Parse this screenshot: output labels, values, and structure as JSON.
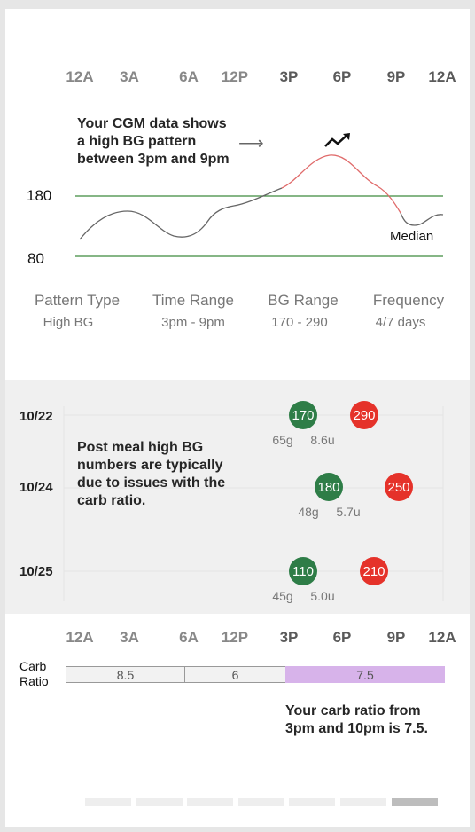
{
  "hours": [
    "12A",
    "3A",
    "6A",
    "12P",
    "3P",
    "6P",
    "9P",
    "12A"
  ],
  "top": {
    "message": [
      "Your CGM data shows",
      "a high BG pattern",
      "between 3pm and 9pm"
    ],
    "arrow": "⟶",
    "y_labels": [
      "180",
      "80"
    ],
    "median_label": "Median"
  },
  "stats": {
    "headers": [
      "Pattern Type",
      "Time Range",
      "BG Range",
      "Frequency"
    ],
    "values": [
      "High BG",
      "3pm - 9pm",
      "170 - 290",
      "4/7 days"
    ]
  },
  "meals": {
    "message": [
      "Post meal high BG",
      "numbers are typically",
      "due to issues with the",
      "carb ratio."
    ],
    "rows": [
      {
        "date": "10/22",
        "pre": "170",
        "post": "290",
        "carbs": "65g",
        "insulin": "8.6u"
      },
      {
        "date": "10/24",
        "pre": "180",
        "post": "250",
        "carbs": "48g",
        "insulin": "5.7u"
      },
      {
        "date": "10/25",
        "pre": "110",
        "post": "210",
        "carbs": "45g",
        "insulin": "5.0u"
      }
    ]
  },
  "carb": {
    "label_line1": "Carb",
    "label_line2": "Ratio",
    "segments": [
      {
        "value": "8.5"
      },
      {
        "value": "6"
      },
      {
        "value": "7.5"
      }
    ],
    "message": [
      "Your carb ratio from",
      "3pm and 10pm is 7.5."
    ]
  },
  "pager": {
    "count": 7,
    "active_index": 6
  },
  "colors": {
    "good": "#2e7d47",
    "high": "#e5322a",
    "threshold_line": "#3f8a3f",
    "curve_high": "#e06b6b",
    "curve_normal": "#666666",
    "highlight": "#d7b3ea"
  }
}
